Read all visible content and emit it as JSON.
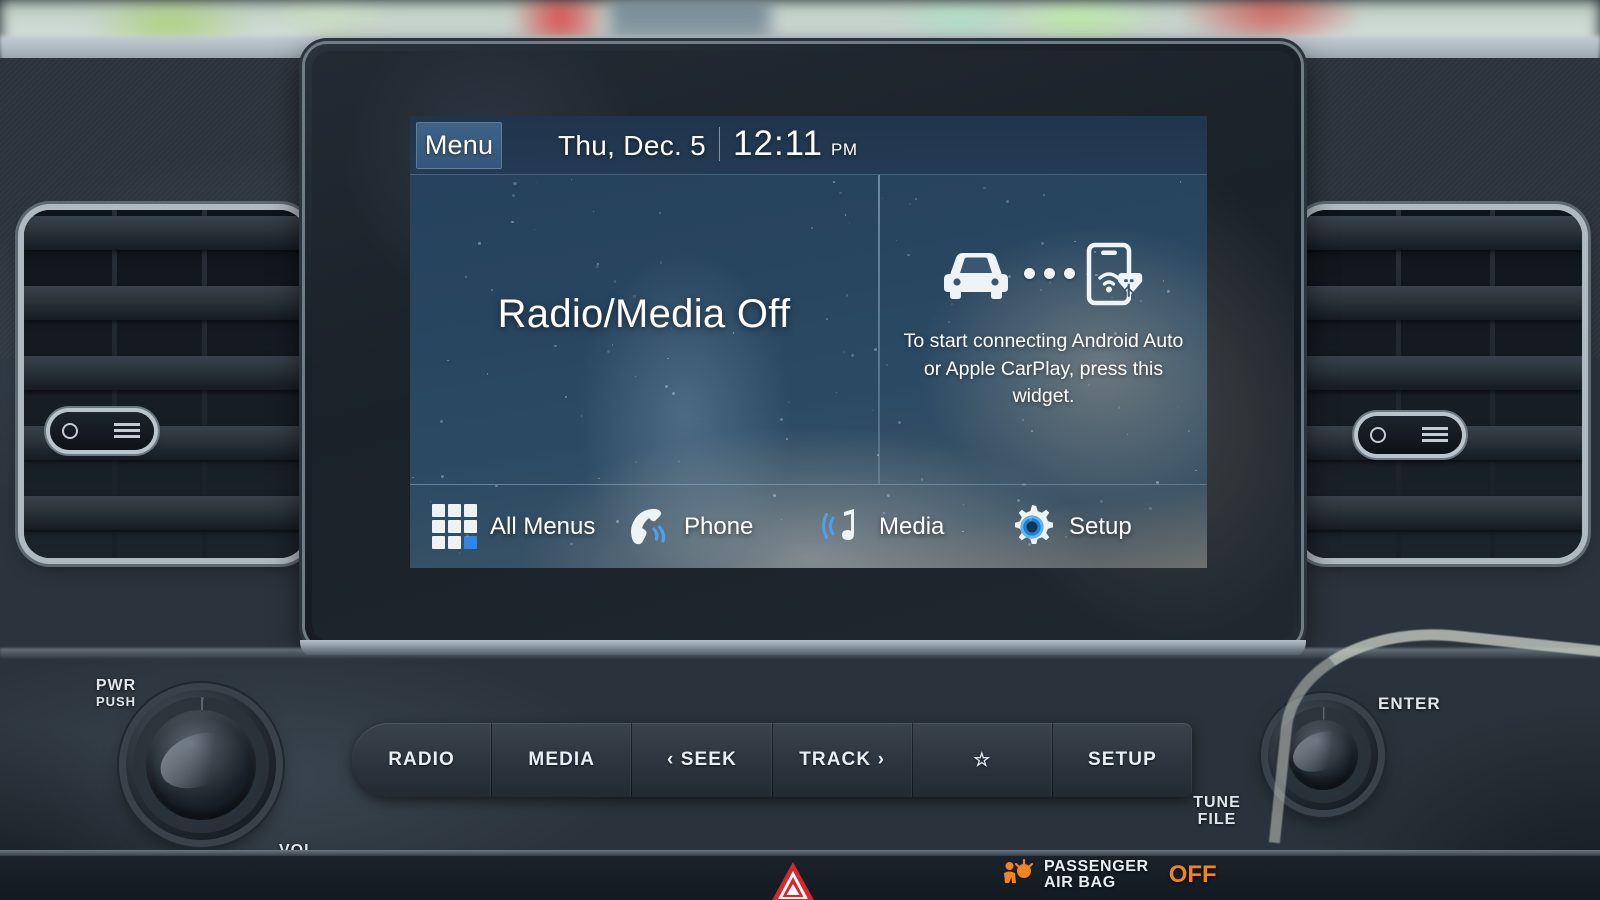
{
  "screen": {
    "statusbar": {
      "menu_label": "Menu",
      "date": "Thu, Dec. 5",
      "time": "12:11",
      "ampm": "PM"
    },
    "left_pane": {
      "status_text": "Radio/Media Off"
    },
    "right_widget": {
      "icons": [
        "car-icon",
        "dots-icon",
        "phone-usb-icon"
      ],
      "prompt": "To start connecting Android Auto or Apple CarPlay, press this widget."
    },
    "nav": [
      {
        "label": "All Menus",
        "icon": "grid-icon"
      },
      {
        "label": "Phone",
        "icon": "phone-handset-icon"
      },
      {
        "label": "Media",
        "icon": "music-note-icon"
      },
      {
        "label": "Setup",
        "icon": "gear-icon"
      }
    ],
    "colors": {
      "accent_blue": "#2f86e8",
      "menu_button": "#3f6287",
      "screen_top": "#25415c",
      "text": "#ffffff"
    }
  },
  "hardware": {
    "buttons": [
      {
        "label": "RADIO"
      },
      {
        "label": "MEDIA"
      },
      {
        "label": "‹ SEEK"
      },
      {
        "label": "TRACK ›"
      },
      {
        "label": "☆"
      },
      {
        "label": "SETUP"
      }
    ],
    "left_knob": {
      "line1": "PWR",
      "line2": "PUSH",
      "below": "VOL"
    },
    "right_knob": {
      "side": "ENTER",
      "line1": "TUNE",
      "line2": "FILE"
    },
    "hazard": {
      "icon": "hazard-triangle-icon"
    },
    "airbag": {
      "line1": "PASSENGER",
      "line2": "AIR BAG",
      "state": "OFF",
      "state_color": "#f08421"
    }
  }
}
